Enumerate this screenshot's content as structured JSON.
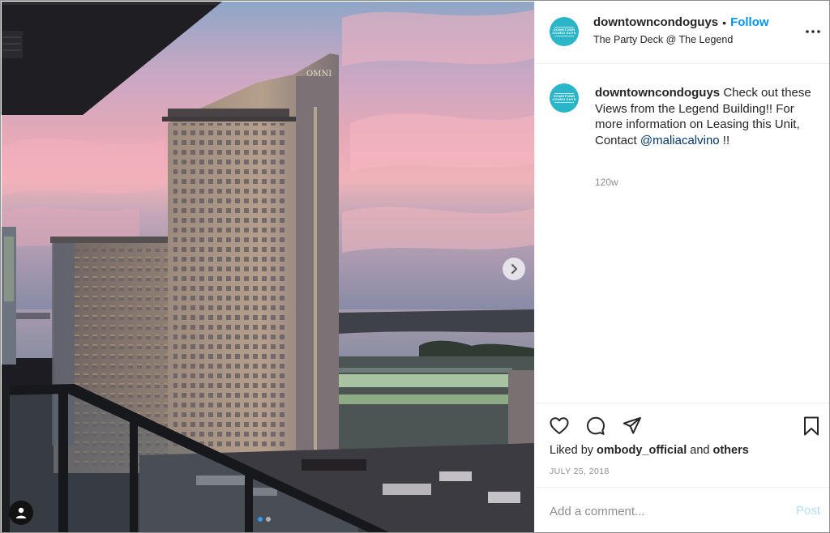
{
  "post": {
    "username": "downtowncondoguys",
    "follow_separator": "•",
    "follow_label": "Follow",
    "location": "The Party Deck @ The Legend",
    "avatar_text": "DOWNTOWN CONDO GUYS",
    "brand_color": "#2bb5c8"
  },
  "media": {
    "building_sign": "OMNI",
    "slide_count": 2,
    "active_slide": 1
  },
  "caption": {
    "username": "downtowncondoguys",
    "text": " Check out these Views from the Legend Building!! For more information on Leasing this Unit, Contact ",
    "mention": "@maliacalvino",
    "suffix": " !!",
    "age": "120w"
  },
  "actions": {
    "icons": [
      "heart-icon",
      "comment-icon",
      "share-icon",
      "bookmark-icon"
    ]
  },
  "likes": {
    "prefix": "Liked by ",
    "user": "ombody_official",
    "middle": " and ",
    "others": "others"
  },
  "date": "JULY 25, 2018",
  "comment": {
    "placeholder": "Add a comment...",
    "post_label": "Post"
  },
  "colors": {
    "link_blue": "#0095f6",
    "mention_blue": "#00376b",
    "muted": "#8e8e8e",
    "post_disabled": "#b2dffc"
  }
}
